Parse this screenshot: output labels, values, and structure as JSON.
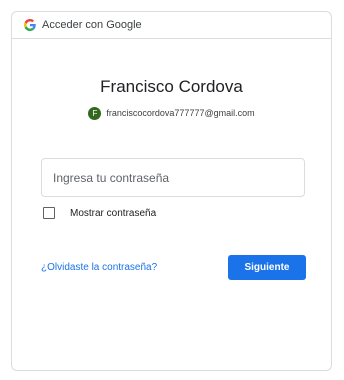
{
  "header": {
    "title": "Acceder con Google",
    "icon": "google-g-icon"
  },
  "account": {
    "name": "Francisco Cordova",
    "avatar_letter": "F",
    "avatar_color": "#33691e",
    "email": "franciscocordova777777@gmail.com"
  },
  "password": {
    "placeholder": "Ingresa tu contraseña",
    "value": ""
  },
  "show_password": {
    "label": "Mostrar contraseña",
    "checked": false
  },
  "actions": {
    "forgot_label": "¿Olvidaste la contraseña?",
    "next_label": "Siguiente"
  },
  "colors": {
    "accent": "#1a73e8",
    "border": "#dadce0"
  }
}
